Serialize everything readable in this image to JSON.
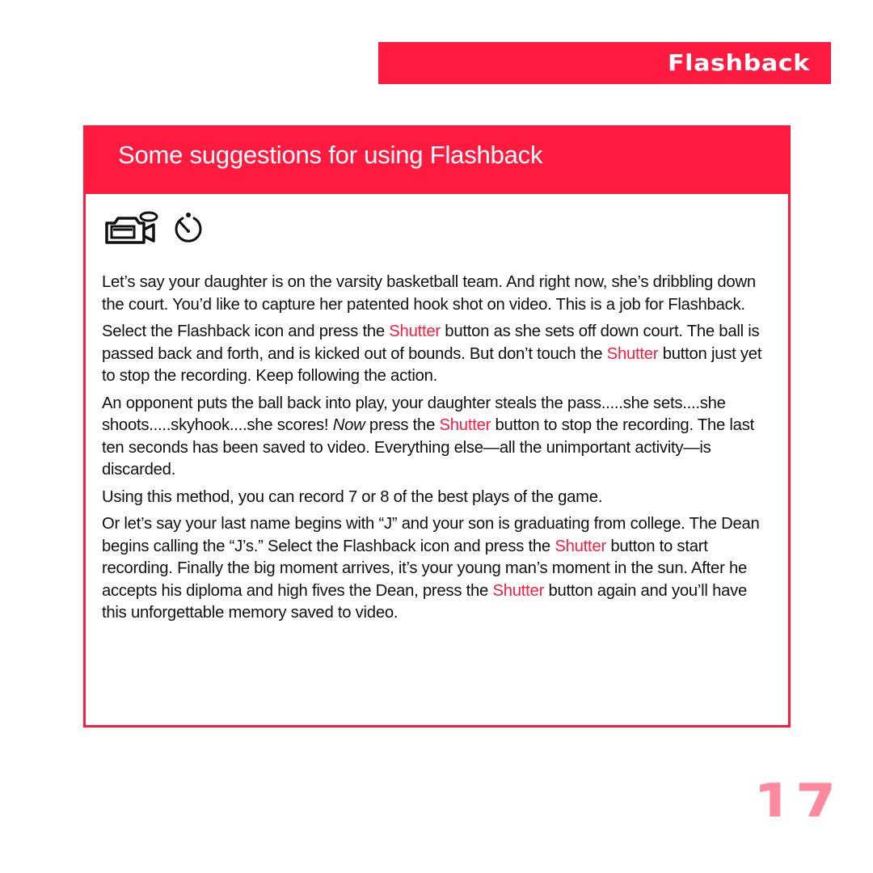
{
  "section_tab": {
    "label": "Flashback"
  },
  "content": {
    "title": "Some suggestions for using Flashback",
    "icons": [
      "video-camera-icon",
      "stopwatch-icon"
    ],
    "paragraphs": [
      {
        "segments": [
          {
            "text": "Let’s say your daughter is on the varsity basketball team. And right now, she’s dribbling down the court. You’d like to capture her patented hook shot on video. This is a job for Flashback."
          }
        ]
      },
      {
        "segments": [
          {
            "text": "Select the Flashback icon and press the "
          },
          {
            "text": "Shutter",
            "style": "accent"
          },
          {
            "text": " button as she sets off down court. The ball is passed back and forth, and is kicked out of bounds. But don’t touch the "
          },
          {
            "text": "Shutter",
            "style": "accent"
          },
          {
            "text": " button just yet to stop the recording. Keep following the action."
          }
        ]
      },
      {
        "segments": [
          {
            "text": "An opponent puts the ball back into play, your daughter steals the pass.....she sets....she shoots.....skyhook....she scores! "
          },
          {
            "text": "Now",
            "style": "italic"
          },
          {
            "text": " press the "
          },
          {
            "text": "Shutter",
            "style": "accent"
          },
          {
            "text": " button to stop the recording. The last ten seconds has been saved to video. Everything else—all the unimportant activity—is discarded."
          }
        ]
      },
      {
        "segments": [
          {
            "text": "Using this method, you can record  7 or 8 of the best plays of the game."
          }
        ]
      },
      {
        "segments": [
          {
            "text": "Or let’s say your last name begins with “J” and your son is graduating from college. The Dean begins calling the “J’s.” Select the Flashback icon and press the "
          },
          {
            "text": "Shutter",
            "style": "accent"
          },
          {
            "text": " button to start recording. Finally the big moment arrives, it’s your young man’s moment in the sun. After he accepts his diploma and high fives the Dean, press the "
          },
          {
            "text": "Shutter",
            "style": "accent"
          },
          {
            "text": " button again and you’ll have this unforgettable memory saved to video."
          }
        ]
      }
    ]
  },
  "page_number": "17",
  "colors": {
    "accent": "#ff1b3f",
    "page_number": "#ff8aa0",
    "text": "#111111"
  }
}
